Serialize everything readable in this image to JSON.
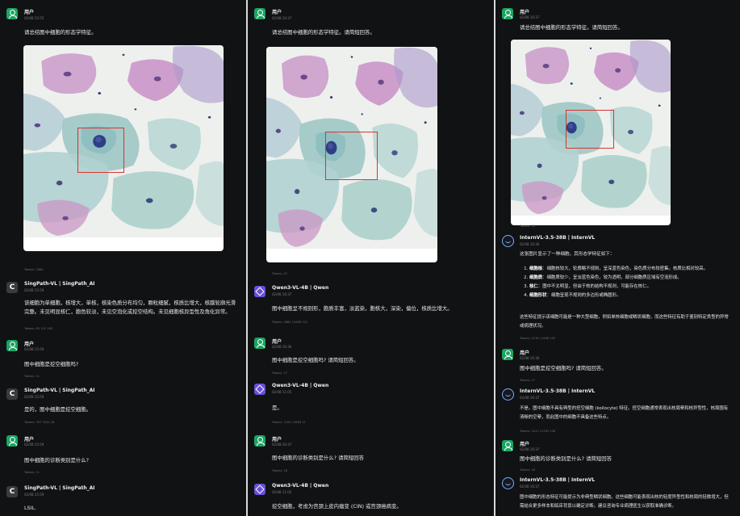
{
  "panels": {
    "p1": {
      "user1": {
        "name": "用户",
        "time": "02/08 15:55",
        "text": "请总结图中细胞的形态学特征。",
        "tokens": "Tokens: 7664"
      },
      "bot1": {
        "name": "SingPath-VL | SingPath_AI",
        "time": "02/08 15:59",
        "text": "该细胞为单细胞，核增大，单核，核染色质分布均匀，颗粒细腻，核质比增大，核膜轮廓光滑完整。未见明显核仁，胞色较淡，未见空泡化或挖空结构。未见细胞核异型性及角化异常。",
        "tokens": "Tokens: 83  191  183"
      },
      "user2": {
        "name": "用户",
        "time": "02/08 15:59",
        "text": "图中细胞是挖空细胞吗?",
        "tokens": "Tokens: 11"
      },
      "bot2": {
        "name": "SingPath-VL | SingPath_AI",
        "time": "02/08 15:59",
        "text": "是的，图中细胞是挖空细胞。",
        "tokens": "Tokens: 337  1525  18"
      },
      "user3": {
        "name": "用户",
        "time": "02/08 15:59",
        "text": "图中细胞的诊断类别是什么?",
        "tokens": "Tokens: 11"
      },
      "bot3": {
        "name": "SingPath-VL | SingPath_AI",
        "time": "02/08 15:59",
        "text": "LSIL."
      }
    },
    "p2": {
      "user1": {
        "name": "用户",
        "time": "02/08 16:37",
        "text": "请总结图中细胞的形态学特征。请简短回答。",
        "tokens": "Tokens: 22"
      },
      "bot1": {
        "name": "Qwen3-VL-4B | Qwen",
        "time": "02/08 16:37",
        "text": "图中细胞呈不规则形，胞质丰富，淡蓝染，胞核大，深染，偏位，核质比增大。",
        "tokens": "Tokens: 1682  11608  122"
      },
      "user2": {
        "name": "用户",
        "time": "02/08 16:36",
        "text": "图中细胞是挖空细胞吗? 请简短回答。",
        "tokens": "Tokens: 17"
      },
      "bot2": {
        "name": "Qwen3-VL-4B | Qwen",
        "time": "02/08 11:05",
        "text": "是。",
        "tokens": "Tokens: 1102  11684  11"
      },
      "user3": {
        "name": "用户",
        "time": "02/08 16:37",
        "text": "图中细胞的诊断类别是什么? 请简短回答",
        "tokens": "Tokens: 18"
      },
      "bot3": {
        "name": "Qwen3-VL-4B | Qwen",
        "time": "02/08 11:05",
        "text": "挖空细胞，考虑为宫颈上皮内瘤变 (CIN) 或宫颈癌病变。"
      }
    },
    "p3": {
      "user1": {
        "name": "用户",
        "time": "02/08 16:37",
        "text": "请总结图中细胞的形态学特征。请简短回答。",
        "tokens": "Tokens: 22"
      },
      "bot1": {
        "name": "InternVL-3.5-38B | InternVL",
        "time": "02/08 16:36",
        "intro": "这张图片显示了一种细胞，其形态学特征如下：",
        "items": [
          {
            "label": "细胞核",
            "text": "：细胞核较大，轮廓略不规则，呈深蓝色染色，染色质分布较密集。核质比相对较高。"
          },
          {
            "label": "细胞质",
            "text": "：细胞质较少，呈淡蓝色染色，较为透明，部分细胞质区域有空泡形成。"
          },
          {
            "label": "核仁",
            "text": "：图中不太明显，但由于核的结构不规则，可能存在核仁。"
          },
          {
            "label": "细胞形状",
            "text": "：细胞呈现不规则的多边形或椭圆形。"
          }
        ],
        "outro": "这些特征提示该细胞可能是一种大型细胞，例如单核细胞或鳞状细胞，而这些特征有助于鉴别特定类型的异常或病理状况。",
        "tokens": "Tokens: 2118  11466  150"
      },
      "user2": {
        "name": "用户",
        "time": "02/08 16:36",
        "text": "图中细胞是挖空细胞吗? 请简短回答。",
        "tokens": "Tokens: 17"
      },
      "bot2": {
        "name": "InternVL-3.5-38B | InternVL",
        "time": "02/08 16:37",
        "text": "不是。图中细胞不具有典型的挖空细胞 (koilocyte) 特征。挖空细胞通常表现出核周晕和核异型性，核周围有清晰的空晕，而此图中的细胞不具备这些特点。",
        "tokens": "Tokens: 2411  11762  136"
      },
      "user3": {
        "name": "用户",
        "time": "02/08 16:37",
        "text": "图中细胞的诊断类别是什么? 请简短回答",
        "tokens": "Tokens: 18"
      },
      "bot3": {
        "name": "InternVL-3.5-38B | InternVL",
        "time": "02/08 16:37",
        "text": "图中细胞的形态特征可能提示为非典型鳞状细胞。这些细胞可能表现出核的轻度异型性和核周的轻微增大，但需结合更多样本和临床背景以确定诊断。建议咨询专业病理医生以获取准确诊断。"
      }
    }
  },
  "colors": {
    "background": "#111214",
    "user_avatar": "#1aa462",
    "qwen_avatar": "#6a4fd8",
    "bbox": "#d6342e"
  }
}
